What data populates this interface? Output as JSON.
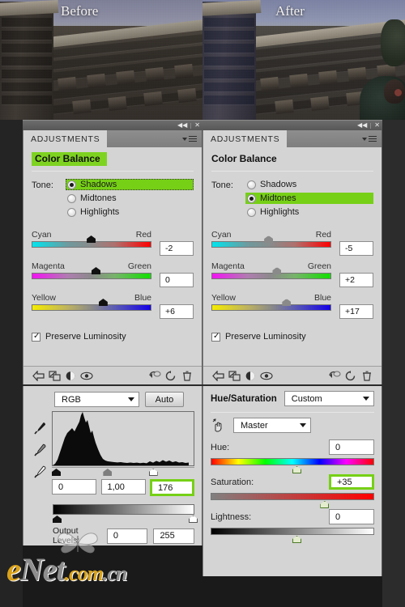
{
  "photos": {
    "before_label": "Before",
    "after_label": "After"
  },
  "left_column": {
    "titlebar": {
      "collapse_icon": "◀◀",
      "close_icon": "✕"
    },
    "adjustments_panel": {
      "tab_label": "ADJUSTMENTS",
      "title": "Color Balance",
      "tone_label": "Tone:",
      "tone_options": [
        {
          "label": "Shadows",
          "selected": true
        },
        {
          "label": "Midtones",
          "selected": false
        },
        {
          "label": "Highlights",
          "selected": false
        }
      ],
      "sliders": [
        {
          "left_label": "Cyan",
          "right_label": "Red",
          "value": "-2",
          "thumb_pct": 46
        },
        {
          "left_label": "Magenta",
          "right_label": "Green",
          "value": "0",
          "thumb_pct": 50
        },
        {
          "left_label": "Yellow",
          "right_label": "Blue",
          "value": "+6",
          "thumb_pct": 56
        }
      ],
      "preserve_luminosity_label": "Preserve Luminosity"
    },
    "levels_panel": {
      "channel": "RGB",
      "auto_button": "Auto",
      "input_black": "0",
      "input_gamma": "1,00",
      "input_white": "176",
      "output_levels_label": "Output Levels:",
      "output_black": "0",
      "output_white": "255"
    }
  },
  "right_column": {
    "titlebar": {
      "collapse_icon": "◀◀",
      "close_icon": "✕"
    },
    "adjustments_panel": {
      "tab_label": "ADJUSTMENTS",
      "title": "Color Balance",
      "tone_label": "Tone:",
      "tone_options": [
        {
          "label": "Shadows",
          "selected": false
        },
        {
          "label": "Midtones",
          "selected": true
        },
        {
          "label": "Highlights",
          "selected": false
        }
      ],
      "sliders": [
        {
          "left_label": "Cyan",
          "right_label": "Red",
          "value": "-5",
          "thumb_pct": 44
        },
        {
          "left_label": "Magenta",
          "right_label": "Green",
          "value": "+2",
          "thumb_pct": 51
        },
        {
          "left_label": "Yellow",
          "right_label": "Blue",
          "value": "+17",
          "thumb_pct": 59
        }
      ],
      "preserve_luminosity_label": "Preserve Luminosity"
    },
    "hue_sat_panel": {
      "title": "Hue/Saturation",
      "preset": "Custom",
      "channel": "Master",
      "fields": [
        {
          "label": "Hue:",
          "value": "0",
          "thumb_pct": 50,
          "highlight": false
        },
        {
          "label": "Saturation:",
          "value": "+35",
          "thumb_pct": 67,
          "highlight": true
        },
        {
          "label": "Lightness:",
          "value": "0",
          "thumb_pct": 50,
          "highlight": false
        }
      ]
    }
  },
  "toolbar_icons": [
    "back-arrow-icon",
    "clip-to-layer-icon",
    "mask-toggle-icon",
    "eye-visibility-icon",
    "preview-previous-icon",
    "reset-icon",
    "delete-trash-icon"
  ],
  "watermark": {
    "prefix": "e",
    "main": "Net",
    "suffix": ".com",
    "tld": ".cn"
  },
  "colors": {
    "highlight_green": "#76d016",
    "panel_bg": "#d4d4d4",
    "titlebar": "#5f5f5f"
  }
}
